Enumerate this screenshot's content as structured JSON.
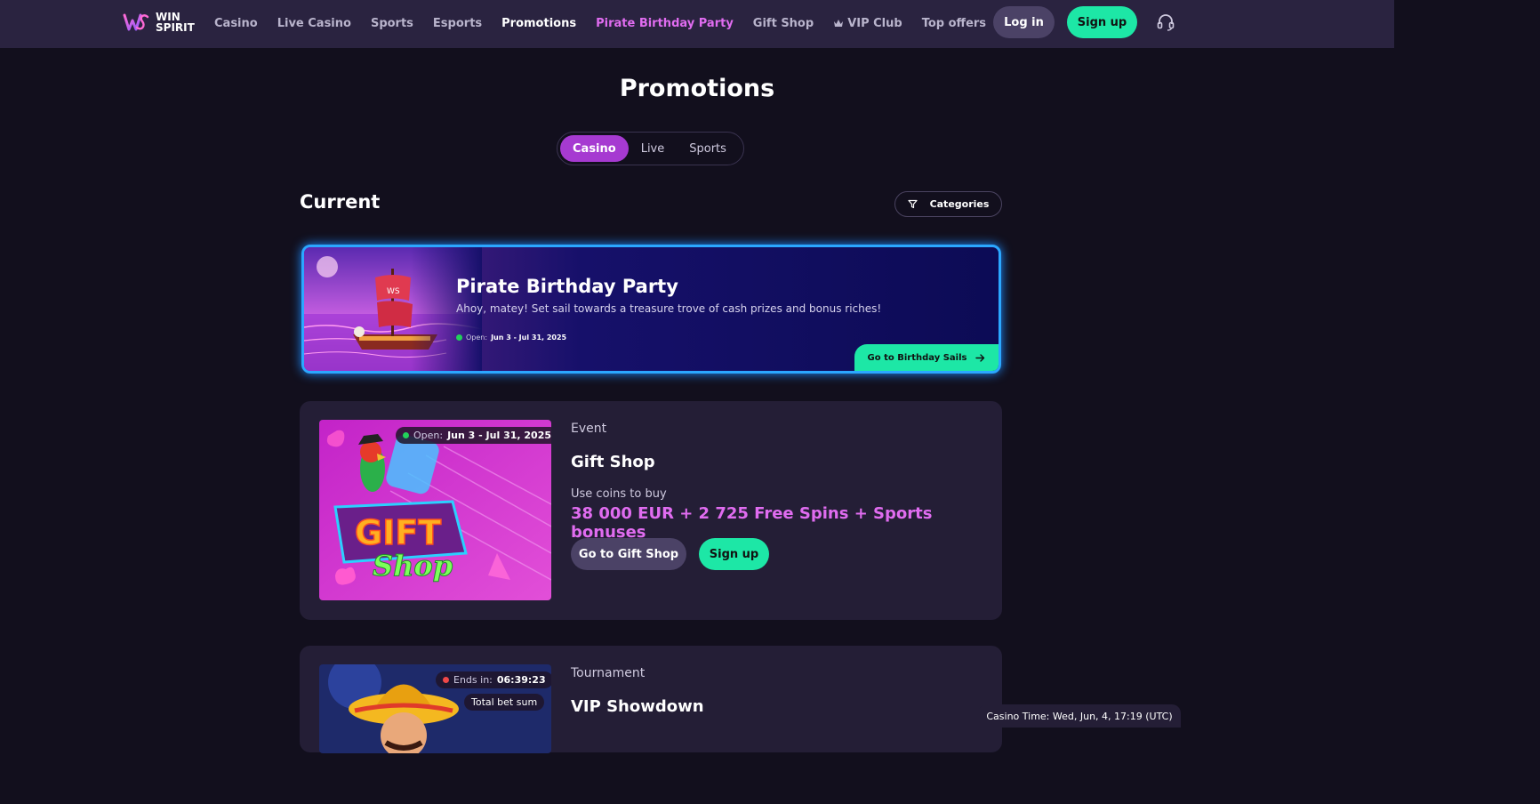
{
  "header": {
    "logo_line1": "WIN",
    "logo_line2": "SPIRIT",
    "nav": [
      {
        "label": "Casino"
      },
      {
        "label": "Live Casino"
      },
      {
        "label": "Sports"
      },
      {
        "label": "Esports"
      },
      {
        "label": "Promotions"
      },
      {
        "label": "Pirate Birthday Party"
      },
      {
        "label": "Gift Shop"
      },
      {
        "label": "VIP Club"
      },
      {
        "label": "Top offers"
      }
    ],
    "more_label": "•••",
    "login_label": "Log in",
    "signup_label": "Sign up"
  },
  "page": {
    "title": "Promotions",
    "tabs": [
      {
        "label": "Casino"
      },
      {
        "label": "Live"
      },
      {
        "label": "Sports"
      }
    ],
    "section_title": "Current",
    "categories_label": "Categories"
  },
  "hero": {
    "title": "Pirate Birthday Party",
    "subtitle": "Ahoy, matey! Set sail towards a treasure trove of cash prizes and bonus riches!",
    "open_label": "Open:",
    "open_dates": "Jun 3 - Jul 31, 2025",
    "button_label": "Go to Birthday Sails"
  },
  "cards": [
    {
      "badge_label": "Open:",
      "badge_value": "Jun 3 - Jul 31, 2025",
      "image_gift": "GIFT",
      "image_shop": "Shop",
      "type": "Event",
      "title": "Gift Shop",
      "note": "Use coins to buy",
      "highlight": "38 000 EUR + 2 725 Free Spins + Sports bonuses",
      "button_primary": "Go to Gift Shop",
      "button_secondary": "Sign up"
    },
    {
      "badge_label": "Ends in:",
      "badge_value": "06:39:23",
      "badge2": "Total bet sum",
      "type": "Tournament",
      "title": "VIP Showdown"
    }
  ],
  "footer": {
    "casino_time": "Casino Time: Wed, Jun, 4, 17:19 (UTC)"
  },
  "colors": {
    "accent_green": "#1de7a6",
    "accent_pink": "#e06cf0",
    "tab_active": "#a63ad1",
    "hero_border": "#2ba7ff"
  }
}
